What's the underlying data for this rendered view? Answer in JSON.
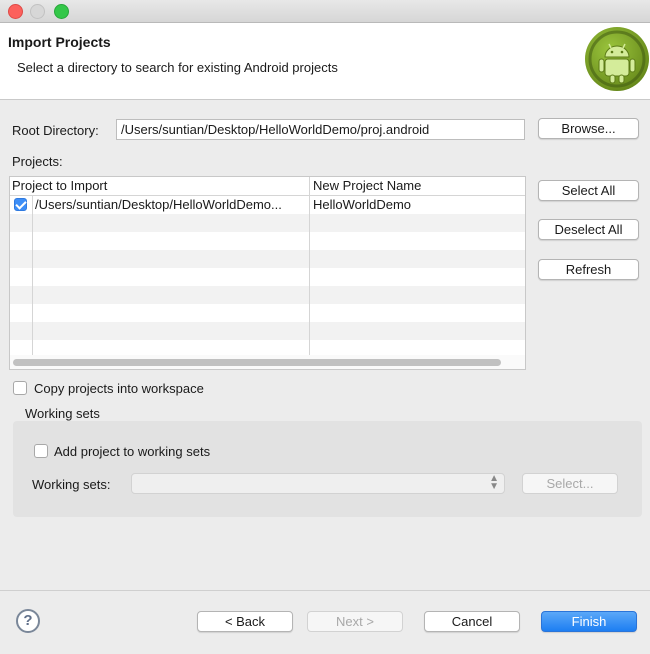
{
  "window": {
    "title": ""
  },
  "header": {
    "title": "Import Projects",
    "description": "Select a directory to search for existing Android projects",
    "logo_icon": "android-logo-icon"
  },
  "root_directory": {
    "label": "Root Directory:",
    "value": "/Users/suntian/Desktop/HelloWorldDemo/proj.android",
    "browse_label": "Browse..."
  },
  "projects": {
    "label": "Projects:",
    "columns": [
      "Project to Import",
      "New Project Name"
    ],
    "rows": [
      {
        "checked": true,
        "project": "/Users/suntian/Desktop/HelloWorldDemo...",
        "name": "HelloWorldDemo"
      }
    ],
    "select_all_label": "Select All",
    "deselect_all_label": "Deselect All",
    "refresh_label": "Refresh"
  },
  "copy_projects": {
    "label": "Copy projects into workspace",
    "checked": false
  },
  "working_sets": {
    "group_label": "Working sets",
    "add_label": "Add project to working sets",
    "add_checked": false,
    "field_label": "Working sets:",
    "value": "",
    "select_label": "Select..."
  },
  "footer": {
    "help_icon": "help-icon",
    "back_label": "< Back",
    "next_label": "Next >",
    "cancel_label": "Cancel",
    "finish_label": "Finish"
  },
  "colors": {
    "accent": "#1d7ef2",
    "checkbox": "#3d8ef7",
    "logo": "#9bc53d"
  }
}
